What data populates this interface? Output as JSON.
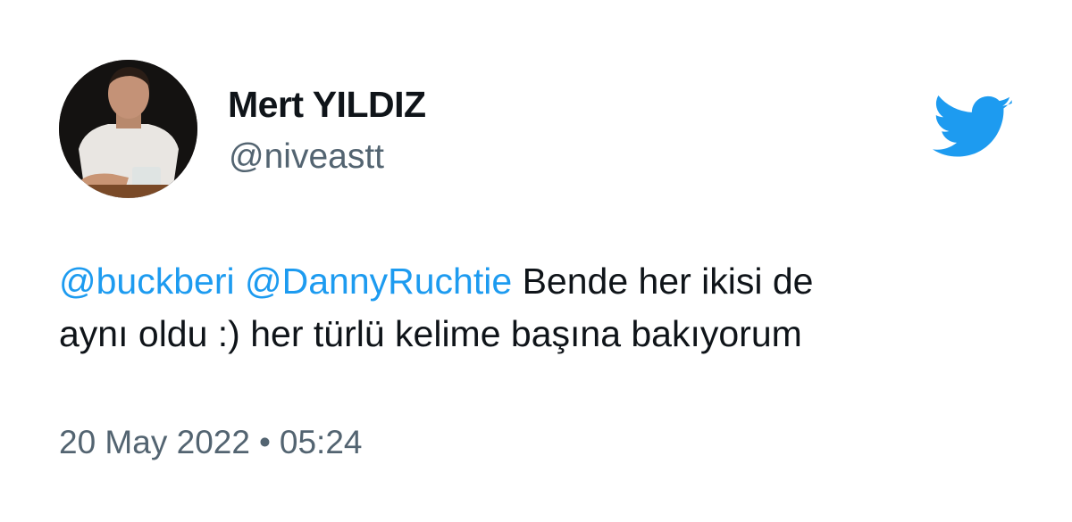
{
  "author": {
    "name": "Mert YILDIZ",
    "handle": "@niveastt",
    "avatar_icon": "profile-photo"
  },
  "brand": {
    "icon": "twitter-bird-icon",
    "color": "#1d9bf0"
  },
  "tweet": {
    "mentions": [
      "@buckberi",
      "@DannyRuchtie"
    ],
    "text_line1": "Bende her ikisi de",
    "text_line2": "aynı oldu :) her türlü kelime başına bakıyorum"
  },
  "meta": {
    "date": "20 May 2022",
    "separator": "•",
    "time": "05:24"
  },
  "colors": {
    "text": "#0f1419",
    "secondary": "#536471",
    "link": "#1d9bf0"
  }
}
